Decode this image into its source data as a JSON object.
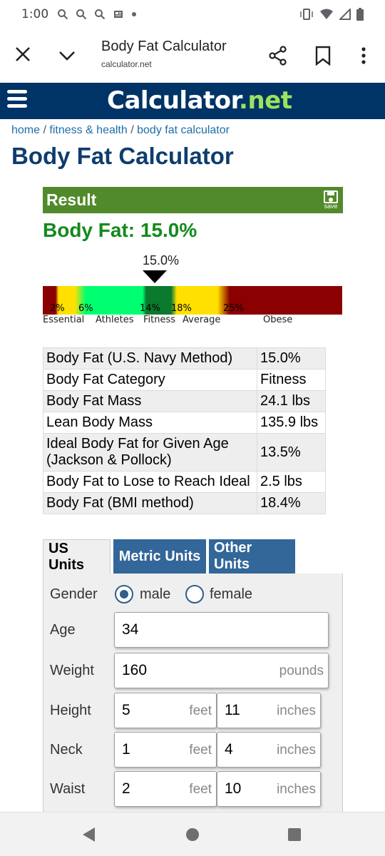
{
  "status": {
    "time": "1:00"
  },
  "browser": {
    "title": "Body Fat Calculator",
    "url": "calculator.net"
  },
  "site": {
    "logo_main": "Calculator",
    "logo_dot": ".",
    "logo_net": "net"
  },
  "breadcrumb": {
    "home": "home",
    "sep1": " / ",
    "fitness": "fitness & health",
    "sep2": " / ",
    "current": "body fat calculator"
  },
  "page_title": "Body Fat Calculator",
  "result": {
    "header": "Result",
    "save_label": "save",
    "headline": "Body Fat: 15.0%",
    "gauge_value": "15.0%",
    "ticks": [
      "2%",
      "6%",
      "14%",
      "18%",
      "25%"
    ],
    "categories": [
      "Essential",
      "Athletes",
      "Fitness",
      "Average",
      "Obese"
    ]
  },
  "table": [
    {
      "label": "Body Fat (U.S. Navy Method)",
      "value": "15.0%"
    },
    {
      "label": "Body Fat Category",
      "value": "Fitness"
    },
    {
      "label": "Body Fat Mass",
      "value": "24.1 lbs"
    },
    {
      "label": "Lean Body Mass",
      "value": "135.9 lbs"
    },
    {
      "label": "Ideal Body Fat for Given Age (Jackson & Pollock)",
      "value": "13.5%"
    },
    {
      "label": "Body Fat to Lose to Reach Ideal",
      "value": "2.5 lbs"
    },
    {
      "label": "Body Fat (BMI method)",
      "value": "18.4%"
    }
  ],
  "tabs": [
    "US Units",
    "Metric Units",
    "Other Units"
  ],
  "form": {
    "gender_label": "Gender",
    "male": "male",
    "female": "female",
    "age_label": "Age",
    "age": "34",
    "weight_label": "Weight",
    "weight": "160",
    "weight_unit": "pounds",
    "height_label": "Height",
    "height_feet": "5",
    "height_inches": "11",
    "neck_label": "Neck",
    "neck_feet": "1",
    "neck_inches": "4",
    "waist_label": "Waist",
    "waist_feet": "2",
    "waist_inches": "10",
    "feet_unit": "feet",
    "inches_unit": "inches"
  }
}
